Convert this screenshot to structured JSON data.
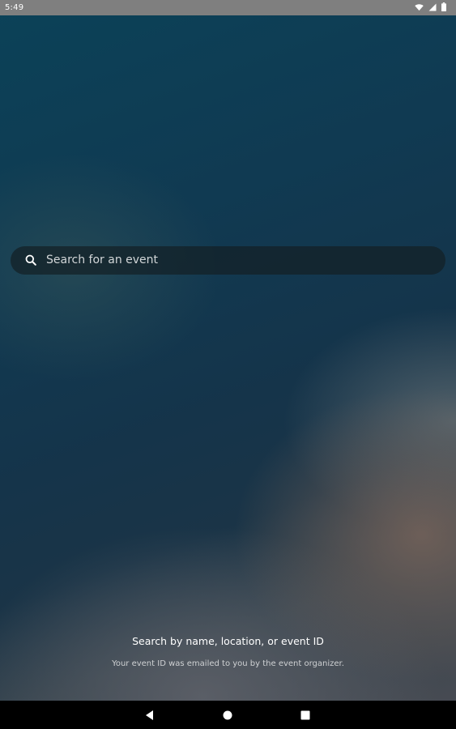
{
  "status_bar": {
    "time": "5:49",
    "icons": [
      "wifi-icon",
      "cellular-signal-icon",
      "battery-icon"
    ]
  },
  "search": {
    "placeholder": "Search for an event",
    "icon": "search-icon"
  },
  "hint": {
    "title": "Search by name, location, or event ID",
    "subtitle": "Your event ID was emailed to you by the event organizer."
  },
  "nav_bar": {
    "buttons": [
      "back-icon",
      "home-icon",
      "recents-icon"
    ]
  },
  "colors": {
    "status_bar_bg": "#7f7f7f",
    "background_top": "#0b4258",
    "background_bottom": "#4a4c53",
    "search_bg": "#142026",
    "nav_bar_bg": "#000000"
  }
}
